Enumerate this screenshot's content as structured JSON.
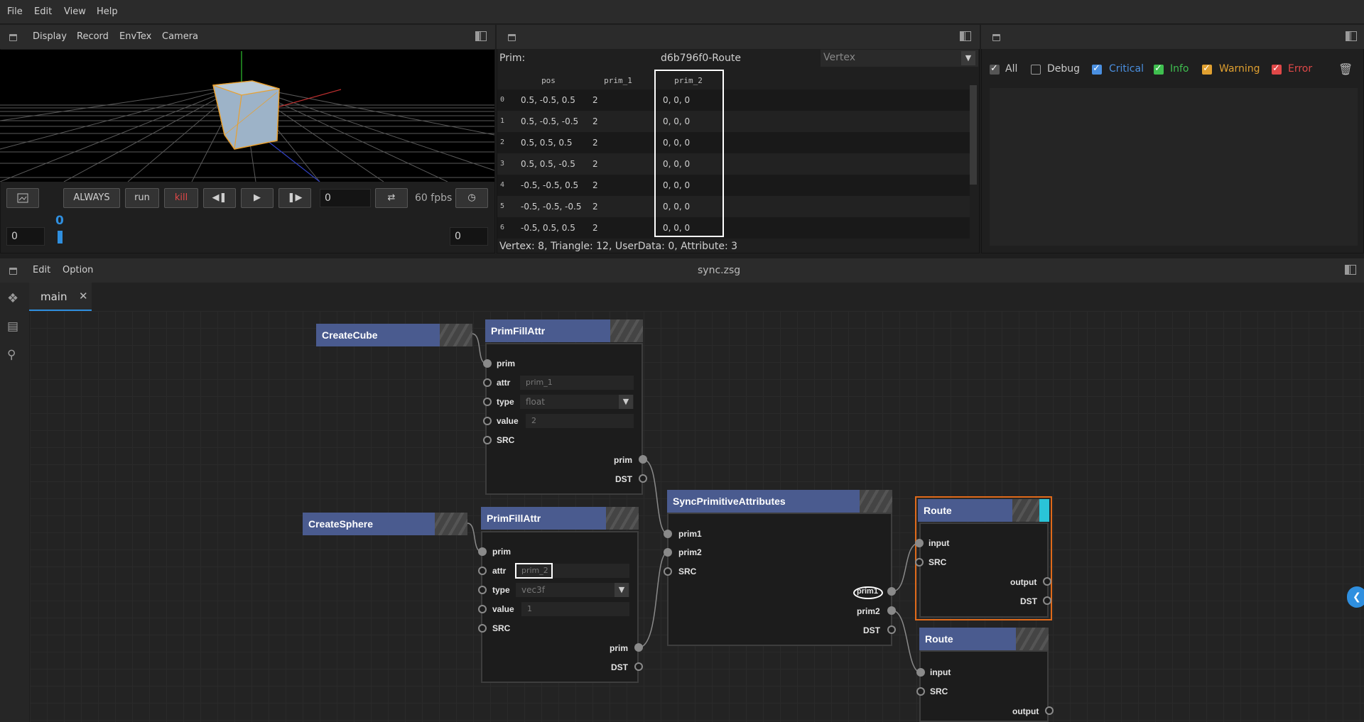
{
  "menubar": {
    "file": "File",
    "edit": "Edit",
    "view": "View",
    "help": "Help"
  },
  "viewport_panel": {
    "menu": {
      "display": "Display",
      "record": "Record",
      "envtex": "EnvTex",
      "camera": "Camera"
    },
    "controls": {
      "always": "ALWAYS",
      "run": "run",
      "kill": "kill",
      "frame_value": "0",
      "fps": "60 fpbs",
      "timeline_start": "0",
      "timeline_current": "0",
      "timeline_end": "0"
    }
  },
  "spreadsheet": {
    "prim_label": "Prim:",
    "prim_name": "d6b796f0-Route",
    "mode": "Vertex",
    "columns": [
      "pos",
      "prim_1",
      "prim_2"
    ],
    "rows": [
      {
        "index": "0",
        "pos": "0.5, -0.5, 0.5",
        "prim_1": "2",
        "prim_2": "0, 0, 0"
      },
      {
        "index": "1",
        "pos": "0.5, -0.5, -0.5",
        "prim_1": "2",
        "prim_2": "0, 0, 0"
      },
      {
        "index": "2",
        "pos": "0.5, 0.5, 0.5",
        "prim_1": "2",
        "prim_2": "0, 0, 0"
      },
      {
        "index": "3",
        "pos": "0.5, 0.5, -0.5",
        "prim_1": "2",
        "prim_2": "0, 0, 0"
      },
      {
        "index": "4",
        "pos": "-0.5, -0.5, 0.5",
        "prim_1": "2",
        "prim_2": "0, 0, 0"
      },
      {
        "index": "5",
        "pos": "-0.5, -0.5, -0.5",
        "prim_1": "2",
        "prim_2": "0, 0, 0"
      },
      {
        "index": "6",
        "pos": "-0.5, 0.5, 0.5",
        "prim_1": "2",
        "prim_2": "0, 0, 0"
      }
    ],
    "status": "Vertex: 8, Triangle: 12, UserData: 0, Attribute: 3"
  },
  "log_panel": {
    "filters": [
      {
        "label": "All",
        "checked": true,
        "color": "#d0d0d0"
      },
      {
        "label": "Debug",
        "checked": false,
        "color": "#d0d0d0"
      },
      {
        "label": "Critical",
        "checked": true,
        "color": "#4a8fe0"
      },
      {
        "label": "Info",
        "checked": true,
        "color": "#3fbf4f"
      },
      {
        "label": "Warning",
        "checked": true,
        "color": "#e0a030"
      },
      {
        "label": "Error",
        "checked": true,
        "color": "#e04848"
      }
    ]
  },
  "editor": {
    "menu": {
      "edit": "Edit",
      "option": "Option"
    },
    "file_title": "sync.zsg",
    "tab": "main"
  },
  "nodes": {
    "create_cube": {
      "title": "CreateCube"
    },
    "fill_attr_1": {
      "title": "PrimFillAttr",
      "in_prim": "prim",
      "attr_label": "attr",
      "attr_value": "prim_1",
      "type_label": "type",
      "type_value": "float",
      "value_label": "value",
      "value_value": "2",
      "src": "SRC",
      "out_prim": "prim",
      "dst": "DST"
    },
    "create_sphere": {
      "title": "CreateSphere"
    },
    "fill_attr_2": {
      "title": "PrimFillAttr",
      "in_prim": "prim",
      "attr_label": "attr",
      "attr_value": "prim_2",
      "type_label": "type",
      "type_value": "vec3f",
      "value_label": "value",
      "value_value": "1",
      "src": "SRC",
      "out_prim": "prim",
      "dst": "DST"
    },
    "sync": {
      "title": "SyncPrimitiveAttributes",
      "in_prim1": "prim1",
      "in_prim2": "prim2",
      "src": "SRC",
      "out_prim1": "prim1",
      "out_prim2": "prim2",
      "dst": "DST"
    },
    "route_1": {
      "title": "Route",
      "input": "input",
      "src": "SRC",
      "output": "output",
      "dst": "DST"
    },
    "route_2": {
      "title": "Route",
      "input": "input",
      "src": "SRC",
      "output": "output"
    }
  },
  "colors": {
    "node_header": "#4a5b8f",
    "selected_outline": "#e06a1a",
    "accent_blue": "#2f8fdf",
    "kill_red": "#e04848"
  }
}
